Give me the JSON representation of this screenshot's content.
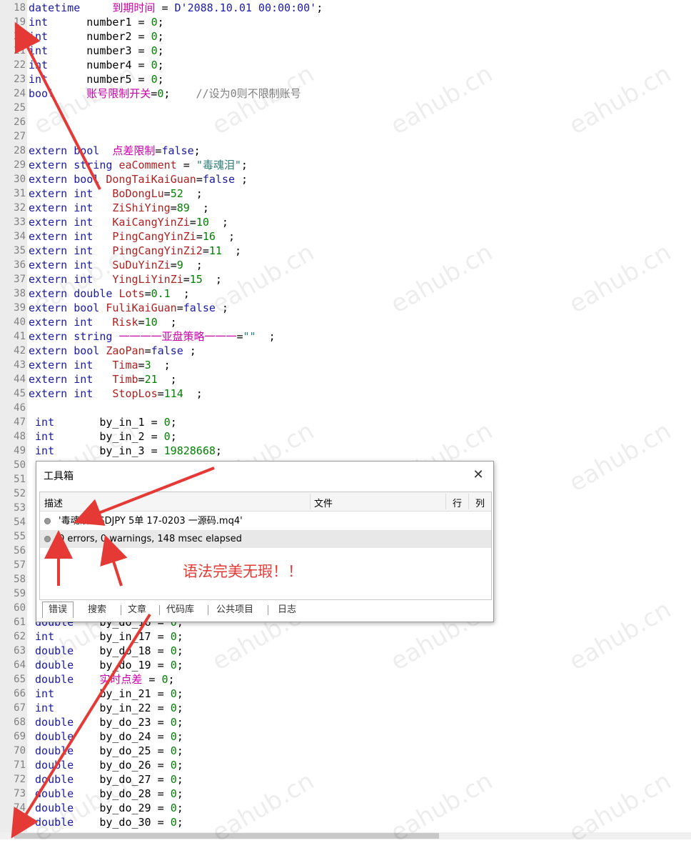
{
  "editor": {
    "lines": [
      {
        "n": "18",
        "t": [
          [
            "kw",
            "datetime"
          ],
          [
            "plain",
            "     "
          ],
          [
            "cn",
            "到期时间"
          ],
          [
            "plain",
            " = "
          ],
          [
            "kw",
            "D'2088.10.01 00:00:00'"
          ],
          [
            "plain",
            ";"
          ]
        ]
      },
      {
        "n": "19",
        "t": [
          [
            "kw",
            "int"
          ],
          [
            "plain",
            "      number1 = "
          ],
          [
            "num",
            "0"
          ],
          [
            "plain",
            ";"
          ]
        ]
      },
      {
        "n": "20",
        "t": [
          [
            "kw",
            "int"
          ],
          [
            "plain",
            "      number2 = "
          ],
          [
            "num",
            "0"
          ],
          [
            "plain",
            ";"
          ]
        ]
      },
      {
        "n": "21",
        "t": [
          [
            "kw",
            "int"
          ],
          [
            "plain",
            "      number3 = "
          ],
          [
            "num",
            "0"
          ],
          [
            "plain",
            ";"
          ]
        ]
      },
      {
        "n": "22",
        "t": [
          [
            "kw",
            "int"
          ],
          [
            "plain",
            "      number4 = "
          ],
          [
            "num",
            "0"
          ],
          [
            "plain",
            ";"
          ]
        ]
      },
      {
        "n": "23",
        "t": [
          [
            "kw",
            "int"
          ],
          [
            "plain",
            "      number5 = "
          ],
          [
            "num",
            "0"
          ],
          [
            "plain",
            ";"
          ]
        ]
      },
      {
        "n": "24",
        "t": [
          [
            "kw",
            "bool"
          ],
          [
            "plain",
            "     "
          ],
          [
            "cn",
            "账号限制开关"
          ],
          [
            "plain",
            "="
          ],
          [
            "num",
            "0"
          ],
          [
            "plain",
            ";    "
          ],
          [
            "cm",
            "//设为0则不限制账号"
          ]
        ]
      },
      {
        "n": "25",
        "t": []
      },
      {
        "n": "26",
        "t": []
      },
      {
        "n": "27",
        "t": []
      },
      {
        "n": "28",
        "t": [
          [
            "kw",
            "extern bool"
          ],
          [
            "plain",
            "  "
          ],
          [
            "cn",
            "点差限制"
          ],
          [
            "plain",
            "="
          ],
          [
            "kw",
            "false"
          ],
          [
            "plain",
            ";"
          ]
        ]
      },
      {
        "n": "29",
        "t": [
          [
            "kw",
            "extern string"
          ],
          [
            "plain",
            " "
          ],
          [
            "id",
            "eaComment"
          ],
          [
            "plain",
            " = "
          ],
          [
            "str",
            "\"毒魂泪\""
          ],
          [
            "plain",
            ";"
          ]
        ]
      },
      {
        "n": "30",
        "t": [
          [
            "kw",
            "extern bool"
          ],
          [
            "plain",
            " "
          ],
          [
            "id",
            "DongTaiKaiGuan"
          ],
          [
            "plain",
            "="
          ],
          [
            "kw",
            "false"
          ],
          [
            "plain",
            " ;"
          ]
        ]
      },
      {
        "n": "31",
        "t": [
          [
            "kw",
            "extern int"
          ],
          [
            "plain",
            "   "
          ],
          [
            "id",
            "BoDongLu"
          ],
          [
            "plain",
            "="
          ],
          [
            "num",
            "52"
          ],
          [
            "plain",
            "  ;"
          ]
        ]
      },
      {
        "n": "32",
        "t": [
          [
            "kw",
            "extern int"
          ],
          [
            "plain",
            "   "
          ],
          [
            "id",
            "ZiShiYing"
          ],
          [
            "plain",
            "="
          ],
          [
            "num",
            "89"
          ],
          [
            "plain",
            "  ;"
          ]
        ]
      },
      {
        "n": "33",
        "t": [
          [
            "kw",
            "extern int"
          ],
          [
            "plain",
            "   "
          ],
          [
            "id",
            "KaiCangYinZi"
          ],
          [
            "plain",
            "="
          ],
          [
            "num",
            "10"
          ],
          [
            "plain",
            "  ;"
          ]
        ]
      },
      {
        "n": "34",
        "t": [
          [
            "kw",
            "extern int"
          ],
          [
            "plain",
            "   "
          ],
          [
            "id",
            "PingCangYinZi"
          ],
          [
            "plain",
            "="
          ],
          [
            "num",
            "16"
          ],
          [
            "plain",
            "  ;"
          ]
        ]
      },
      {
        "n": "35",
        "t": [
          [
            "kw",
            "extern int"
          ],
          [
            "plain",
            "   "
          ],
          [
            "id",
            "PingCangYinZi2"
          ],
          [
            "plain",
            "="
          ],
          [
            "num",
            "11"
          ],
          [
            "plain",
            "  ;"
          ]
        ]
      },
      {
        "n": "36",
        "t": [
          [
            "kw",
            "extern int"
          ],
          [
            "plain",
            "   "
          ],
          [
            "id",
            "SuDuYinZi"
          ],
          [
            "plain",
            "="
          ],
          [
            "num",
            "9"
          ],
          [
            "plain",
            "  ;"
          ]
        ]
      },
      {
        "n": "37",
        "t": [
          [
            "kw",
            "extern int"
          ],
          [
            "plain",
            "   "
          ],
          [
            "id",
            "YingLiYinZi"
          ],
          [
            "plain",
            "="
          ],
          [
            "num",
            "15"
          ],
          [
            "plain",
            "  ;"
          ]
        ]
      },
      {
        "n": "38",
        "t": [
          [
            "kw",
            "extern double"
          ],
          [
            "plain",
            " "
          ],
          [
            "id",
            "Lots"
          ],
          [
            "plain",
            "="
          ],
          [
            "num",
            "0.1"
          ],
          [
            "plain",
            "  ;"
          ]
        ]
      },
      {
        "n": "39",
        "t": [
          [
            "kw",
            "extern bool"
          ],
          [
            "plain",
            " "
          ],
          [
            "id",
            "FuliKaiGuan"
          ],
          [
            "plain",
            "="
          ],
          [
            "kw",
            "false"
          ],
          [
            "plain",
            " ;"
          ]
        ]
      },
      {
        "n": "40",
        "t": [
          [
            "kw",
            "extern int"
          ],
          [
            "plain",
            "   "
          ],
          [
            "id",
            "Risk"
          ],
          [
            "plain",
            "="
          ],
          [
            "num",
            "10"
          ],
          [
            "plain",
            "  ;"
          ]
        ]
      },
      {
        "n": "41",
        "t": [
          [
            "kw",
            "extern string"
          ],
          [
            "plain",
            " "
          ],
          [
            "cn",
            "一一一一亚盘策略一一一"
          ],
          [
            "plain",
            "="
          ],
          [
            "str",
            "\"\""
          ],
          [
            "plain",
            "  ;"
          ]
        ]
      },
      {
        "n": "42",
        "t": [
          [
            "kw",
            "extern bool"
          ],
          [
            "plain",
            " "
          ],
          [
            "id",
            "ZaoPan"
          ],
          [
            "plain",
            "="
          ],
          [
            "kw",
            "false"
          ],
          [
            "plain",
            " ;"
          ]
        ]
      },
      {
        "n": "43",
        "t": [
          [
            "kw",
            "extern int"
          ],
          [
            "plain",
            "   "
          ],
          [
            "id",
            "Tima"
          ],
          [
            "plain",
            "="
          ],
          [
            "num",
            "3"
          ],
          [
            "plain",
            "  ;"
          ]
        ]
      },
      {
        "n": "44",
        "t": [
          [
            "kw",
            "extern int"
          ],
          [
            "plain",
            "   "
          ],
          [
            "id",
            "Timb"
          ],
          [
            "plain",
            "="
          ],
          [
            "num",
            "21"
          ],
          [
            "plain",
            "  ;"
          ]
        ]
      },
      {
        "n": "45",
        "t": [
          [
            "kw",
            "extern int"
          ],
          [
            "plain",
            "   "
          ],
          [
            "id",
            "StopLos"
          ],
          [
            "plain",
            "="
          ],
          [
            "num",
            "114"
          ],
          [
            "plain",
            "  ;"
          ]
        ]
      },
      {
        "n": "46",
        "t": []
      },
      {
        "n": "47",
        "t": [
          [
            "plain",
            " "
          ],
          [
            "kw",
            "int"
          ],
          [
            "plain",
            "       by_in_1 = "
          ],
          [
            "num",
            "0"
          ],
          [
            "plain",
            ";"
          ]
        ]
      },
      {
        "n": "48",
        "t": [
          [
            "plain",
            " "
          ],
          [
            "kw",
            "int"
          ],
          [
            "plain",
            "       by_in_2 = "
          ],
          [
            "num",
            "0"
          ],
          [
            "plain",
            ";"
          ]
        ]
      },
      {
        "n": "49",
        "t": [
          [
            "plain",
            " "
          ],
          [
            "kw",
            "int"
          ],
          [
            "plain",
            "       by_in_3 = "
          ],
          [
            "num",
            "19828668"
          ],
          [
            "plain",
            ";"
          ]
        ]
      },
      {
        "n": "50",
        "t": []
      },
      {
        "n": "51",
        "t": []
      },
      {
        "n": "52",
        "t": []
      },
      {
        "n": "53",
        "t": []
      },
      {
        "n": "54",
        "t": []
      },
      {
        "n": "55",
        "t": []
      },
      {
        "n": "56",
        "t": []
      },
      {
        "n": "57",
        "t": []
      },
      {
        "n": "58",
        "t": []
      },
      {
        "n": "59",
        "t": []
      },
      {
        "n": "60",
        "t": []
      },
      {
        "n": "61",
        "t": [
          [
            "plain",
            " "
          ],
          [
            "kw",
            "double"
          ],
          [
            "plain",
            "    by_do_16 = "
          ],
          [
            "num",
            "0"
          ],
          [
            "plain",
            ";"
          ]
        ]
      },
      {
        "n": "62",
        "t": [
          [
            "plain",
            " "
          ],
          [
            "kw",
            "int"
          ],
          [
            "plain",
            "       by_in_17 = "
          ],
          [
            "num",
            "0"
          ],
          [
            "plain",
            ";"
          ]
        ]
      },
      {
        "n": "63",
        "t": [
          [
            "plain",
            " "
          ],
          [
            "kw",
            "double"
          ],
          [
            "plain",
            "    by_do_18 = "
          ],
          [
            "num",
            "0"
          ],
          [
            "plain",
            ";"
          ]
        ]
      },
      {
        "n": "64",
        "t": [
          [
            "plain",
            " "
          ],
          [
            "kw",
            "double"
          ],
          [
            "plain",
            "    by_do_19 = "
          ],
          [
            "num",
            "0"
          ],
          [
            "plain",
            ";"
          ]
        ]
      },
      {
        "n": "65",
        "t": [
          [
            "plain",
            " "
          ],
          [
            "kw",
            "double"
          ],
          [
            "plain",
            "    "
          ],
          [
            "cn",
            "实时点差"
          ],
          [
            "plain",
            " = "
          ],
          [
            "num",
            "0"
          ],
          [
            "plain",
            ";"
          ]
        ]
      },
      {
        "n": "66",
        "t": [
          [
            "plain",
            " "
          ],
          [
            "kw",
            "int"
          ],
          [
            "plain",
            "       by_in_21 = "
          ],
          [
            "num",
            "0"
          ],
          [
            "plain",
            ";"
          ]
        ]
      },
      {
        "n": "67",
        "t": [
          [
            "plain",
            " "
          ],
          [
            "kw",
            "int"
          ],
          [
            "plain",
            "       by_in_22 = "
          ],
          [
            "num",
            "0"
          ],
          [
            "plain",
            ";"
          ]
        ]
      },
      {
        "n": "68",
        "t": [
          [
            "plain",
            " "
          ],
          [
            "kw",
            "double"
          ],
          [
            "plain",
            "    by_do_23 = "
          ],
          [
            "num",
            "0"
          ],
          [
            "plain",
            ";"
          ]
        ]
      },
      {
        "n": "69",
        "t": [
          [
            "plain",
            " "
          ],
          [
            "kw",
            "double"
          ],
          [
            "plain",
            "    by_do_24 = "
          ],
          [
            "num",
            "0"
          ],
          [
            "plain",
            ";"
          ]
        ]
      },
      {
        "n": "70",
        "t": [
          [
            "plain",
            " "
          ],
          [
            "kw",
            "double"
          ],
          [
            "plain",
            "    by_do_25 = "
          ],
          [
            "num",
            "0"
          ],
          [
            "plain",
            ";"
          ]
        ]
      },
      {
        "n": "71",
        "t": [
          [
            "plain",
            " "
          ],
          [
            "kw",
            "double"
          ],
          [
            "plain",
            "    by_do_26 = "
          ],
          [
            "num",
            "0"
          ],
          [
            "plain",
            ";"
          ]
        ]
      },
      {
        "n": "72",
        "t": [
          [
            "plain",
            " "
          ],
          [
            "kw",
            "double"
          ],
          [
            "plain",
            "    by_do_27 = "
          ],
          [
            "num",
            "0"
          ],
          [
            "plain",
            ";"
          ]
        ]
      },
      {
        "n": "73",
        "t": [
          [
            "plain",
            " "
          ],
          [
            "kw",
            "double"
          ],
          [
            "plain",
            "    by_do_28 = "
          ],
          [
            "num",
            "0"
          ],
          [
            "plain",
            ";"
          ]
        ]
      },
      {
        "n": "74",
        "t": [
          [
            "plain",
            " "
          ],
          [
            "kw",
            "double"
          ],
          [
            "plain",
            "    by_do_29 = "
          ],
          [
            "num",
            "0"
          ],
          [
            "plain",
            ";"
          ]
        ]
      },
      {
        "n": "75",
        "t": [
          [
            "plain",
            " "
          ],
          [
            "kw",
            "double"
          ],
          [
            "plain",
            "    by_do_30 = "
          ],
          [
            "num",
            "0"
          ],
          [
            "plain",
            ";"
          ]
        ]
      }
    ]
  },
  "toolbox": {
    "title": "工具箱",
    "close": "✕",
    "columns": {
      "desc": "描述",
      "file": "文件",
      "line": "行",
      "col": "列"
    },
    "rows": [
      {
        "text": "'毒魂泪 USDJPY 5单 17-0203 一源码.mq4'"
      },
      {
        "text": "0 errors, 0 warnings, 148 msec elapsed"
      }
    ],
    "annotation": "语法完美无瑕！！",
    "tabs": [
      "错误",
      "搜索",
      "文章",
      "代码库",
      "公共项目",
      "日志"
    ]
  },
  "watermark": "eahub.cn",
  "colors": {
    "keyword": "#1a1aa6",
    "number": "#008000",
    "chinese": "#cc00aa",
    "annotation": "#e53935"
  }
}
